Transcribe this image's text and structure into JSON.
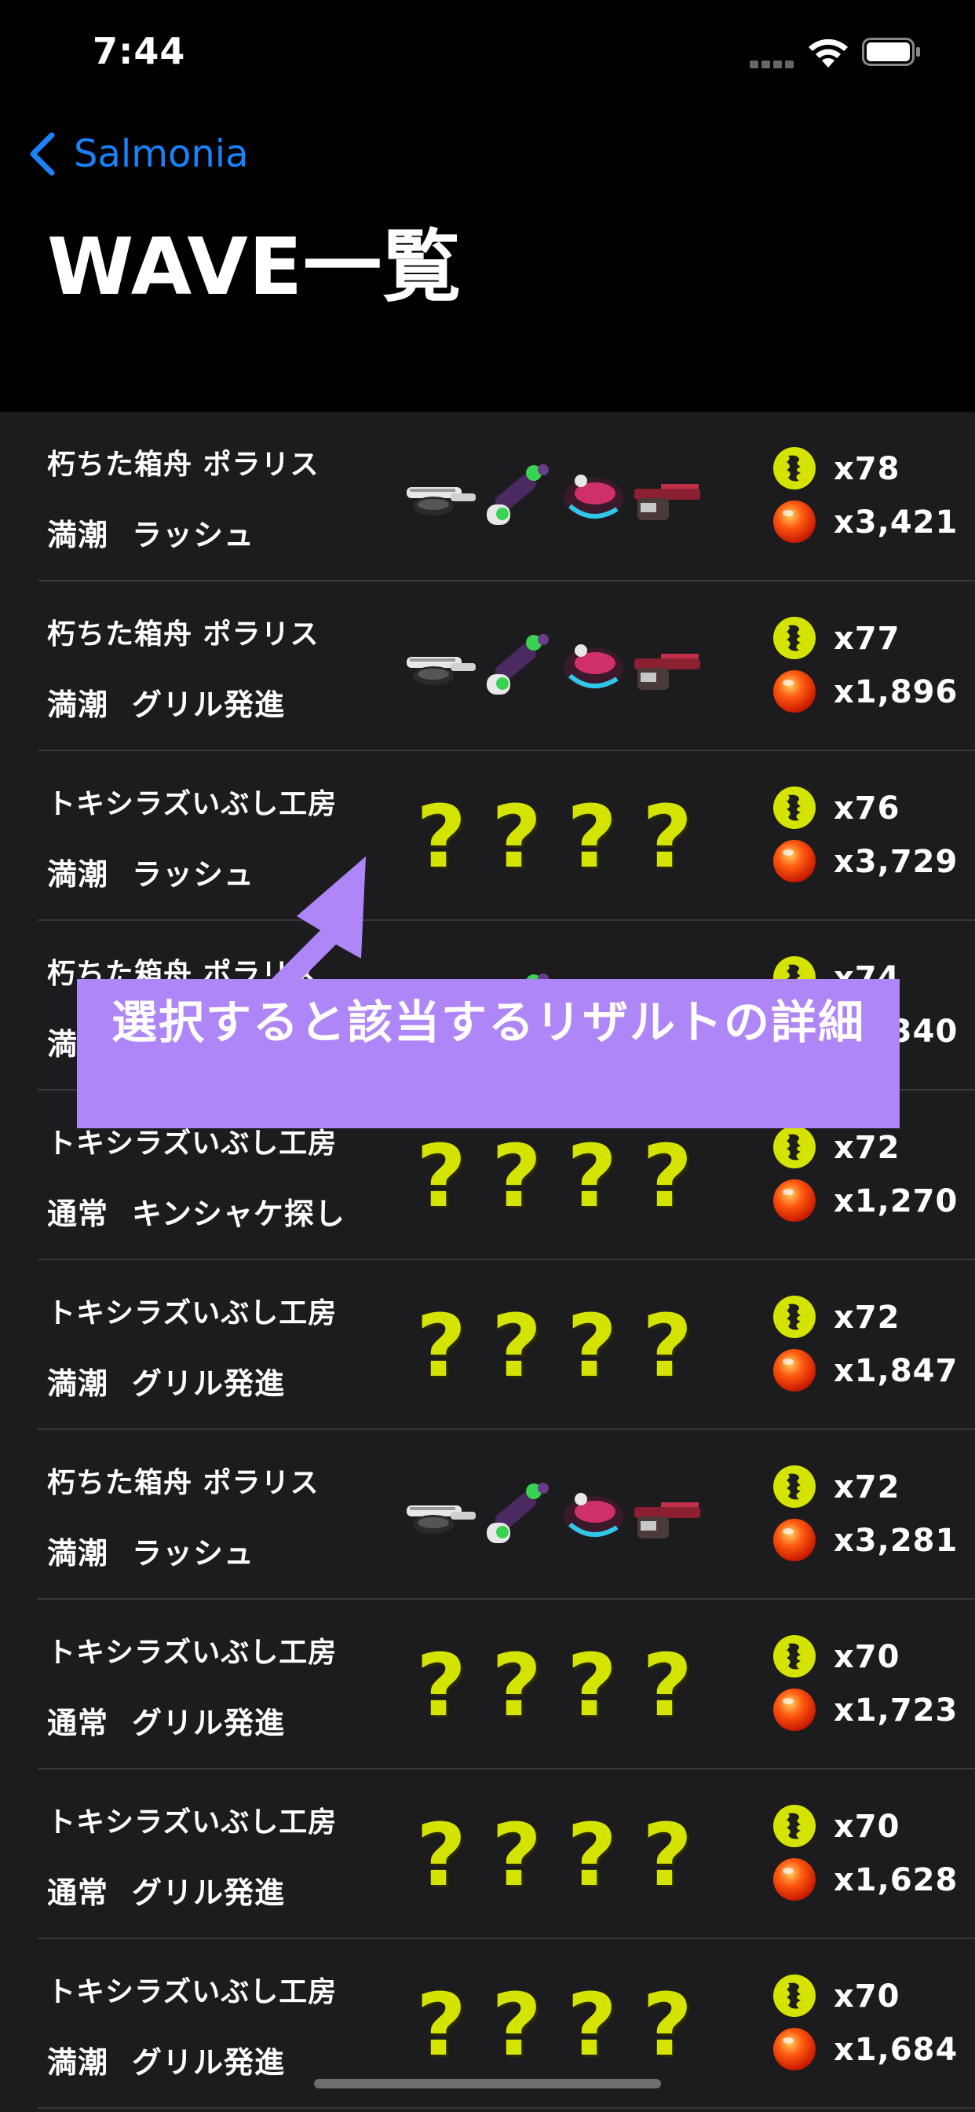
{
  "status_bar": {
    "time": "7:44"
  },
  "nav": {
    "back_label": "Salmonia",
    "title": "WAVE一覧"
  },
  "rows": [
    {
      "stage": "朽ちた箱舟 ポラリス",
      "tide": "満潮",
      "event": "ラッシュ",
      "weapons": "known",
      "golden": "x78",
      "power": "x3,421"
    },
    {
      "stage": "朽ちた箱舟 ポラリス",
      "tide": "満潮",
      "event": "グリル発進",
      "weapons": "known",
      "golden": "x77",
      "power": "x1,896"
    },
    {
      "stage": "トキシラズいぶし工房",
      "tide": "満潮",
      "event": "ラッシュ",
      "weapons": "unknown",
      "golden": "x76",
      "power": "x3,729"
    },
    {
      "stage": "朽ちた箱舟 ポラリス",
      "tide": "満潮",
      "event": "",
      "weapons": "known",
      "golden": "x74",
      "power": "x1,340"
    },
    {
      "stage": "トキシラズいぶし工房",
      "tide": "通常",
      "event": "キンシャケ探し",
      "weapons": "unknown",
      "golden": "x72",
      "power": "x1,270"
    },
    {
      "stage": "トキシラズいぶし工房",
      "tide": "満潮",
      "event": "グリル発進",
      "weapons": "unknown",
      "golden": "x72",
      "power": "x1,847"
    },
    {
      "stage": "朽ちた箱舟 ポラリス",
      "tide": "満潮",
      "event": "ラッシュ",
      "weapons": "known",
      "golden": "x72",
      "power": "x3,281"
    },
    {
      "stage": "トキシラズいぶし工房",
      "tide": "通常",
      "event": "グリル発進",
      "weapons": "unknown",
      "golden": "x70",
      "power": "x1,723"
    },
    {
      "stage": "トキシラズいぶし工房",
      "tide": "通常",
      "event": "グリル発進",
      "weapons": "unknown",
      "golden": "x70",
      "power": "x1,628"
    },
    {
      "stage": "トキシラズいぶし工房",
      "tide": "満潮",
      "event": "グリル発進",
      "weapons": "unknown",
      "golden": "x70",
      "power": "x1,684"
    }
  ],
  "unknown_glyph": "?",
  "annotation": {
    "text": "選択すると該当するリザルトの詳細"
  },
  "colors": {
    "accent": "#1a82fb",
    "annotation_bg": "#af86f8",
    "unknown_weapon": "#d4e400",
    "list_bg": "#1c1c1e"
  },
  "icons": {
    "golden_egg": "golden-egg-icon",
    "power_egg": "power-egg-icon"
  }
}
